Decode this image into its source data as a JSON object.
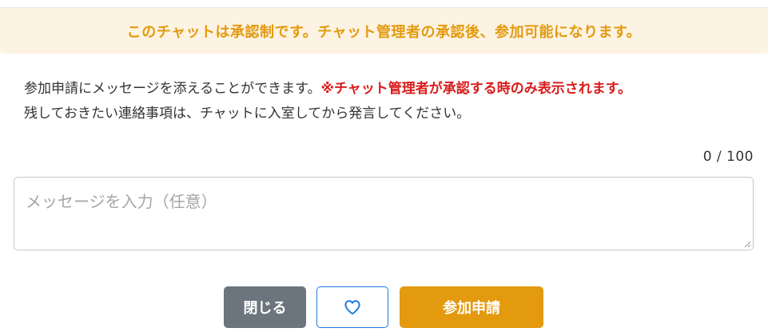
{
  "notice": {
    "text": "このチャットは承認制です。チャット管理者の承認後、参加可能になります。"
  },
  "description": {
    "line1_text": "参加申請にメッセージを添えることができます。",
    "line1_warning": "※チャット管理者が承認する時のみ表示されます。",
    "line2_text": "残しておきたい連絡事項は、チャットに入室してから発言してください。"
  },
  "message": {
    "counter": "0 / 100",
    "value": "",
    "placeholder": "メッセージを入力（任意）"
  },
  "actions": {
    "close_label": "閉じる",
    "like_icon": "heart-outline-icon",
    "apply_label": "参加申請"
  },
  "colors": {
    "notice_bg": "#fdf3e2",
    "notice_text": "#e39a0f",
    "warning_text": "#d91c1c",
    "close_button": "#6c757d",
    "apply_button": "#e39a0f",
    "like_border": "#1f7ae0"
  }
}
